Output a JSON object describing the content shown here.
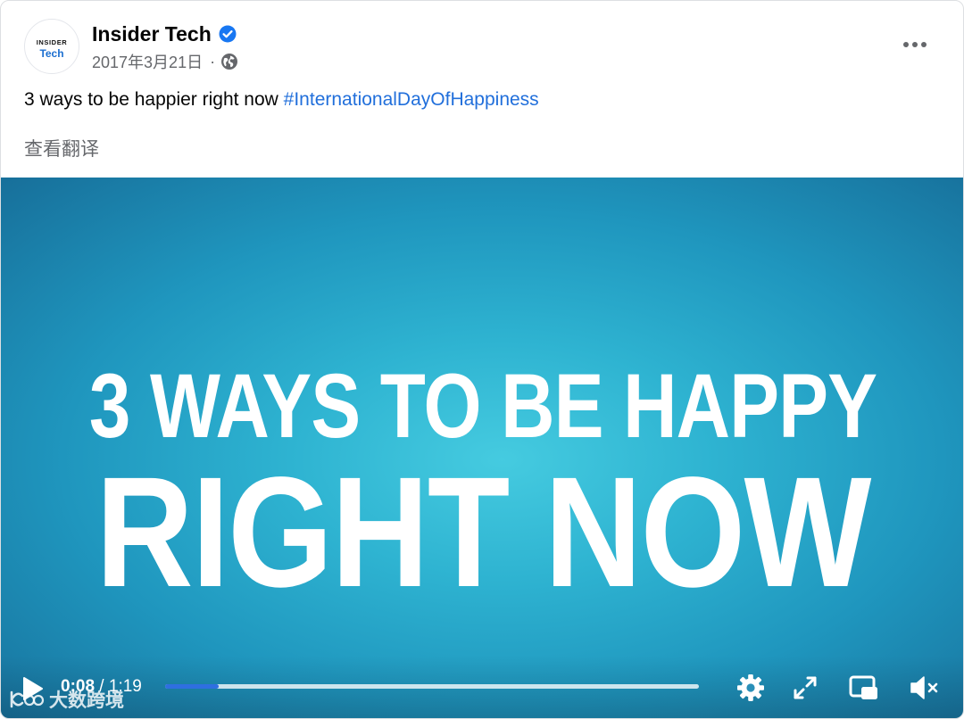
{
  "post": {
    "avatar": {
      "brand_top": "INSIDER",
      "brand_bottom": "Tech"
    },
    "page_name": "Insider Tech",
    "date": "2017年3月21日",
    "meta_separator": "·",
    "text_before_hashtag": "3 ways to be happier right now ",
    "hashtag": "#InternationalDayOfHappiness",
    "translate_label": "查看翻译"
  },
  "video": {
    "headline_line1": "3 WAYS TO BE HAPPY",
    "headline_line2": "RIGHT NOW",
    "current_time": "0:08",
    "time_separator": " / ",
    "duration": "1:19",
    "progress_fraction": 0.1
  },
  "watermark": {
    "text": "大数跨境"
  },
  "icons": {
    "verified": "verified-badge-icon",
    "audience": "globe-icon",
    "more": "more-options-icon",
    "play": "play-icon",
    "settings": "gear-icon",
    "fullscreen": "fullscreen-icon",
    "pip": "picture-in-picture-icon",
    "mute": "muted-speaker-icon"
  },
  "colors": {
    "accent_blue": "#216fdb",
    "verified_blue": "#1877f2",
    "meta_gray": "#65676b",
    "video_bg": "#2eb3d1",
    "progress_fill": "#2f6fe0"
  }
}
